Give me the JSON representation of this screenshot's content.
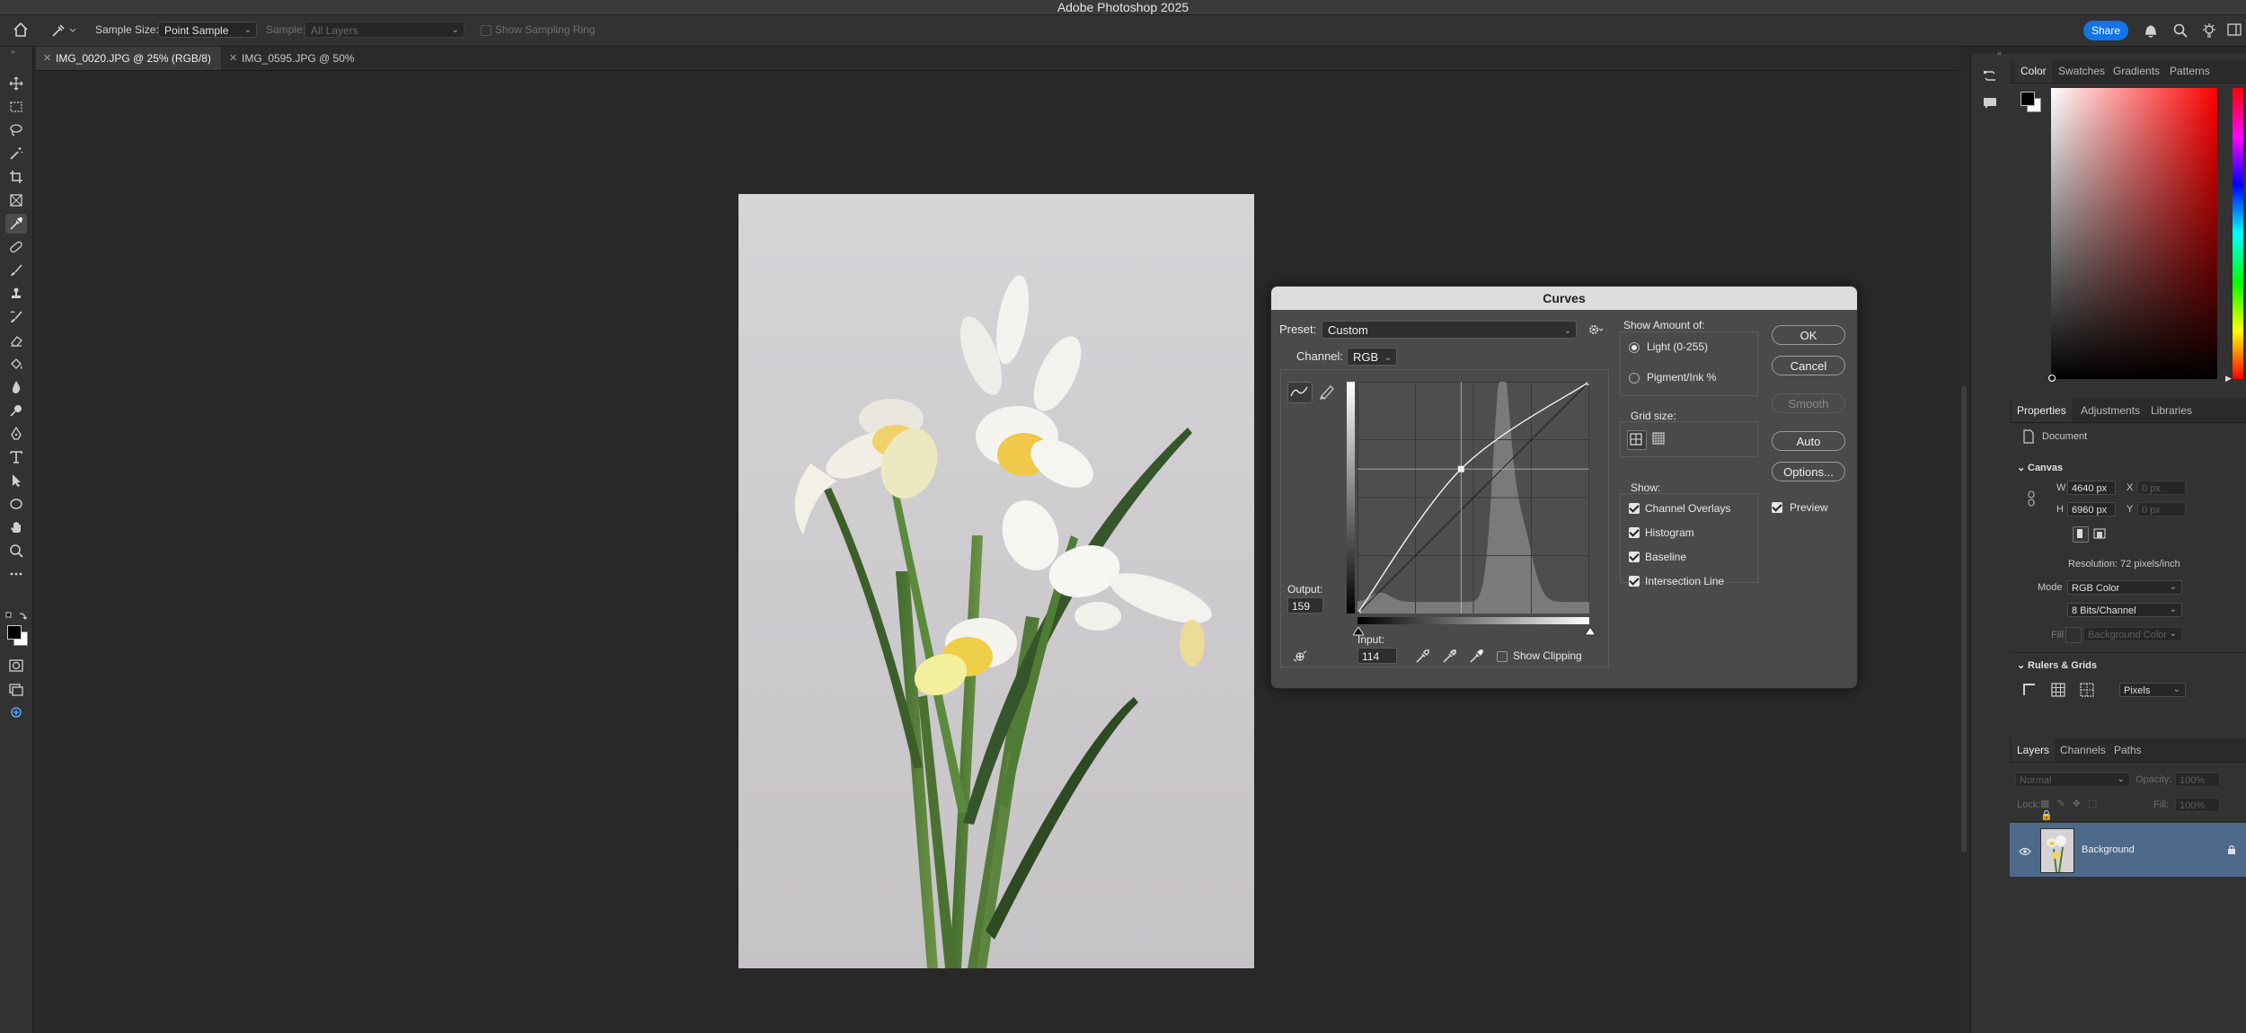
{
  "app": {
    "title": "Adobe Photoshop 2025"
  },
  "options_bar": {
    "sample_size_label": "Sample Size:",
    "sample_size_value": "Point Sample",
    "sample_label": "Sample:",
    "sample_value": "All Layers",
    "show_sampling_ring": "Show Sampling Ring",
    "share_label": "Share"
  },
  "doc_tabs": [
    {
      "label": "IMG_0020.JPG @ 25% (RGB/8) *",
      "active": true
    },
    {
      "label": "IMG_0595.JPG @ 50% (RGB/8)",
      "active": false
    }
  ],
  "curves": {
    "title": "Curves",
    "preset_label": "Preset:",
    "preset_value": "Custom",
    "channel_label": "Channel:",
    "channel_value": "RGB",
    "output_label": "Output:",
    "output_value": "159",
    "input_label": "Input:",
    "input_value": "114",
    "show_clipping": "Show Clipping",
    "show_amount_label": "Show Amount of:",
    "light_option": "Light  (0-255)",
    "pigment_option": "Pigment/Ink %",
    "grid_size_label": "Grid size:",
    "show_label": "Show:",
    "show_options": [
      "Channel Overlays",
      "Histogram",
      "Baseline",
      "Intersection Line"
    ],
    "ok": "OK",
    "cancel": "Cancel",
    "smooth": "Smooth",
    "auto": "Auto",
    "options": "Options...",
    "preview": "Preview",
    "curve_points": [
      {
        "input": 0,
        "output": 0
      },
      {
        "input": 114,
        "output": 159
      },
      {
        "input": 255,
        "output": 255
      }
    ]
  },
  "panels": {
    "color_tabs": [
      "Color",
      "Swatches",
      "Gradients",
      "Patterns"
    ],
    "properties_tabs": [
      "Properties",
      "Adjustments",
      "Libraries"
    ],
    "document_label": "Document",
    "canvas_label": "Canvas",
    "w_label": "W",
    "w_value": "4640 px",
    "h_label": "H",
    "h_value": "6960 px",
    "x_label": "X",
    "x_placeholder": "0 px",
    "y_label": "Y",
    "y_placeholder": "0 px",
    "resolution": "Resolution: 72 pixels/inch",
    "mode_label": "Mode",
    "mode_value": "RGB Color",
    "depth_value": "8 Bits/Channel",
    "fill_label": "Fill",
    "fill_value": "Background Color",
    "rulers_grids_label": "Rulers & Grids",
    "units_value": "Pixels",
    "layers_tabs": [
      "Layers",
      "Channels",
      "Paths"
    ],
    "blend_mode": "Normal",
    "opacity_label": "Opacity:",
    "opacity_value": "100%",
    "lock_label": "Lock:",
    "fill_pct_label": "Fill:",
    "fill_pct_value": "100%",
    "layer_name": "Background"
  },
  "colors": {
    "accent": "#1473e6",
    "layer_selected": "#4d6a8a"
  }
}
